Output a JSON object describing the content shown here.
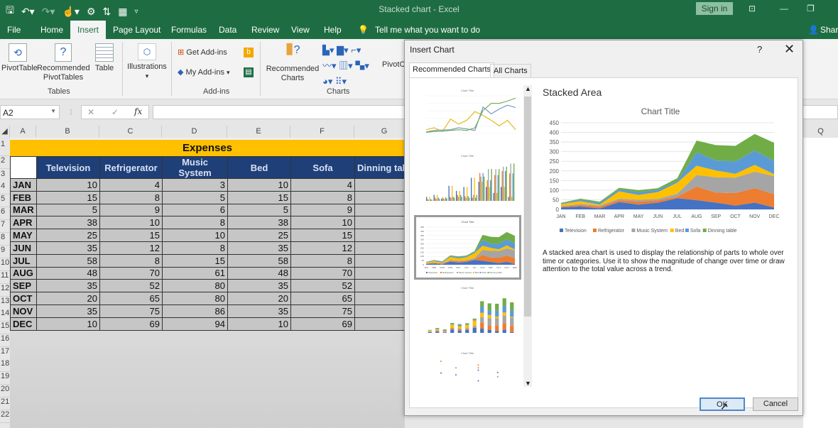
{
  "window": {
    "title": "Stacked chart  -  Excel",
    "sign_in": "Sign in",
    "qat_icons": [
      "save-icon",
      "undo-icon",
      "redo-icon",
      "touch-mode-icon",
      "customize-icon",
      "sort-icon",
      "table-form-icon",
      "qat-dropdown-icon"
    ]
  },
  "menu": {
    "tabs": [
      "File",
      "Home",
      "Insert",
      "Page Layout",
      "Formulas",
      "Data",
      "Review",
      "View",
      "Help"
    ],
    "active_tab": "Insert",
    "tell_me": "Tell me what you want to do",
    "share": "Share"
  },
  "ribbon": {
    "pivot_table": "PivotTable",
    "recommended_pivot": "Recommended PivotTables",
    "table": "Table",
    "tables_group": "Tables",
    "illustrations": "Illustrations",
    "get_addins": "Get Add-ins",
    "my_addins": "My Add-ins",
    "addins_group": "Add-ins",
    "recommended_charts": "Recommended Charts",
    "charts_group": "Charts",
    "pivot_chart": "PivotC"
  },
  "formula_bar": {
    "name_box": "A2",
    "fx": "fx",
    "cancel": "✕",
    "enter": "✓",
    "value": ""
  },
  "columns": [
    "A",
    "B",
    "C",
    "D",
    "E",
    "F",
    "G",
    "Q"
  ],
  "rows": [
    "1",
    "2",
    "3",
    "4",
    "5",
    "6",
    "7",
    "8",
    "9",
    "10",
    "11",
    "12",
    "13",
    "14",
    "15",
    "16",
    "17",
    "18",
    "19",
    "20",
    "21",
    "22"
  ],
  "sheet": {
    "title": "Expenses",
    "headers": [
      "Television",
      "Refrigerator",
      "Music System",
      "Bed",
      "Sofa",
      "Dinning tab"
    ],
    "months": [
      "JAN",
      "FEB",
      "MAR",
      "APR",
      "MAY",
      "JUN",
      "JUL",
      "AUG",
      "SEP",
      "OCT",
      "NOV",
      "DEC"
    ],
    "values": [
      [
        10,
        4,
        3,
        10,
        4
      ],
      [
        15,
        8,
        5,
        15,
        8
      ],
      [
        5,
        9,
        6,
        5,
        9
      ],
      [
        38,
        10,
        8,
        38,
        10
      ],
      [
        25,
        15,
        10,
        25,
        15
      ],
      [
        35,
        12,
        8,
        35,
        12
      ],
      [
        58,
        8,
        15,
        58,
        8
      ],
      [
        48,
        70,
        61,
        48,
        70
      ],
      [
        35,
        52,
        80,
        35,
        52
      ],
      [
        20,
        65,
        80,
        20,
        65
      ],
      [
        35,
        75,
        86,
        35,
        75
      ],
      [
        10,
        69,
        94,
        10,
        69
      ]
    ]
  },
  "dialog": {
    "title": "Insert Chart",
    "help": "?",
    "close": "✕",
    "tabs": [
      "Recommended Charts",
      "All Charts"
    ],
    "selected_chart_name": "Stacked Area",
    "description": "A stacked area chart is used to display the relationship of parts to whole over time or categories. Use it to show the magnitude of change over time or draw attention to the total value across a trend.",
    "ok": "OK",
    "cancel": "Cancel",
    "thumbnails": [
      "Line",
      "Clustered Column",
      "Stacked Area",
      "Stacked Column",
      "Scatter"
    ],
    "selected_thumbnail": 2
  },
  "chart_data": {
    "type": "area",
    "stacked": true,
    "title": "Chart Title",
    "categories": [
      "JAN",
      "FEB",
      "MAR",
      "APR",
      "MAY",
      "JUN",
      "JUL",
      "AUG",
      "SEP",
      "OCT",
      "NOV",
      "DEC"
    ],
    "ylim": [
      0,
      450
    ],
    "yticks": [
      0,
      50,
      100,
      150,
      200,
      250,
      300,
      350,
      400,
      450
    ],
    "grid": true,
    "legend": "bottom",
    "series": [
      {
        "name": "Television",
        "color": "#4472c4",
        "values": [
          10,
          15,
          5,
          38,
          25,
          35,
          58,
          48,
          35,
          20,
          35,
          10
        ]
      },
      {
        "name": "Refrigerator",
        "color": "#ed7d31",
        "values": [
          4,
          8,
          9,
          10,
          15,
          12,
          8,
          70,
          52,
          65,
          75,
          69
        ]
      },
      {
        "name": "Music System",
        "color": "#a5a5a5",
        "values": [
          3,
          5,
          6,
          8,
          10,
          8,
          15,
          61,
          80,
          80,
          86,
          94
        ]
      },
      {
        "name": "Bed",
        "color": "#ffc000",
        "values": [
          10,
          15,
          5,
          38,
          25,
          35,
          58,
          48,
          35,
          20,
          35,
          10
        ]
      },
      {
        "name": "Sofa",
        "color": "#5b9bd5",
        "values": [
          4,
          8,
          9,
          10,
          15,
          12,
          8,
          70,
          52,
          65,
          75,
          69
        ]
      },
      {
        "name": "Dinning table",
        "color": "#70ad47",
        "values": [
          3,
          5,
          6,
          8,
          10,
          8,
          15,
          61,
          80,
          80,
          86,
          94
        ]
      }
    ]
  }
}
